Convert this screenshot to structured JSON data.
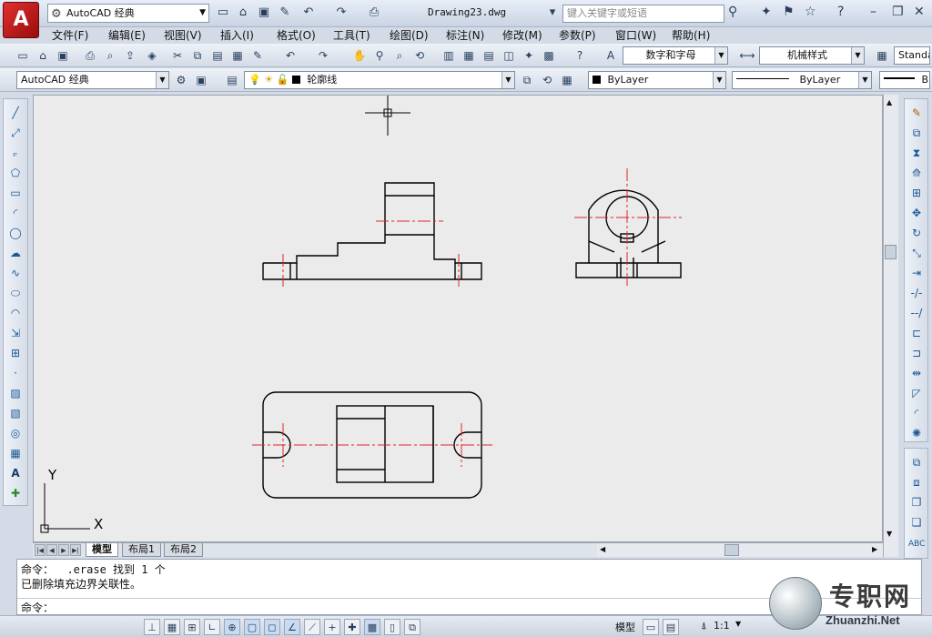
{
  "title_bar": {
    "workspace": "AutoCAD 经典",
    "document": "Drawing23.dwg",
    "search_placeholder": "键入关键字或短语"
  },
  "menu": [
    "文件(F)",
    "编辑(E)",
    "视图(V)",
    "插入(I)",
    "格式(O)",
    "工具(T)",
    "绘图(D)",
    "标注(N)",
    "修改(M)",
    "参数(P)",
    "窗口(W)",
    "帮助(H)"
  ],
  "toolbar1": {
    "text_style": "数字和字母",
    "dim_style": "机械样式",
    "table_style": "Standa"
  },
  "toolbar2": {
    "workspace": "AutoCAD 经典",
    "layer": "轮廓线",
    "color": "ByLayer",
    "linetype": "ByLayer",
    "lineweight": "B"
  },
  "canvas": {
    "ucs_y": "Y",
    "ucs_x": "X"
  },
  "layout_tabs": [
    "模型",
    "布局1",
    "布局2"
  ],
  "command": {
    "line1": "命令：  .erase 找到 1 个",
    "line2": "已删除填充边界关联性。",
    "prompt": "命令："
  },
  "status": {
    "model": "模型",
    "scale": "1:1"
  },
  "watermark": {
    "cn": "专职网",
    "en": "Zhuanzhi.Net"
  },
  "colors": {
    "centerline": "#e0242a",
    "outline": "#000000",
    "canvas": "#ebebeb"
  }
}
